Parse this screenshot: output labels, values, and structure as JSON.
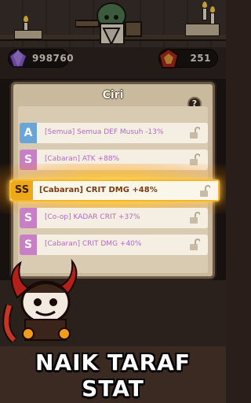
{
  "resources": {
    "gems": {
      "value": "998760",
      "icon": "purple-gem-icon"
    },
    "tokens": {
      "value": "251",
      "icon": "red-emblem-icon"
    }
  },
  "panel": {
    "title": "Ciri",
    "help_label": "?",
    "rows": [
      {
        "grade": "A",
        "text": "[Semua] Semua DEF Musuh -13%",
        "grade_color": "#6aa5d8"
      },
      {
        "grade": "S",
        "text": "[Cabaran] ATK +88%",
        "grade_color": "#c77fc6"
      },
      {
        "grade": "SS",
        "text": "[Cabaran] CRIT DMG +48%",
        "grade_color": "#f0a81b",
        "highlighted": true
      },
      {
        "grade": "S",
        "text": "[Co-op] KADAR CRIT +37%",
        "grade_color": "#c77fc6"
      },
      {
        "grade": "S",
        "text": "[Cabaran] CRIT DMG +40%",
        "grade_color": "#c77fc6"
      }
    ]
  },
  "slogan": "NAIK TARAF STAT",
  "colors": {
    "highlight": "#f6b62a",
    "panel": "#c9b99d"
  }
}
